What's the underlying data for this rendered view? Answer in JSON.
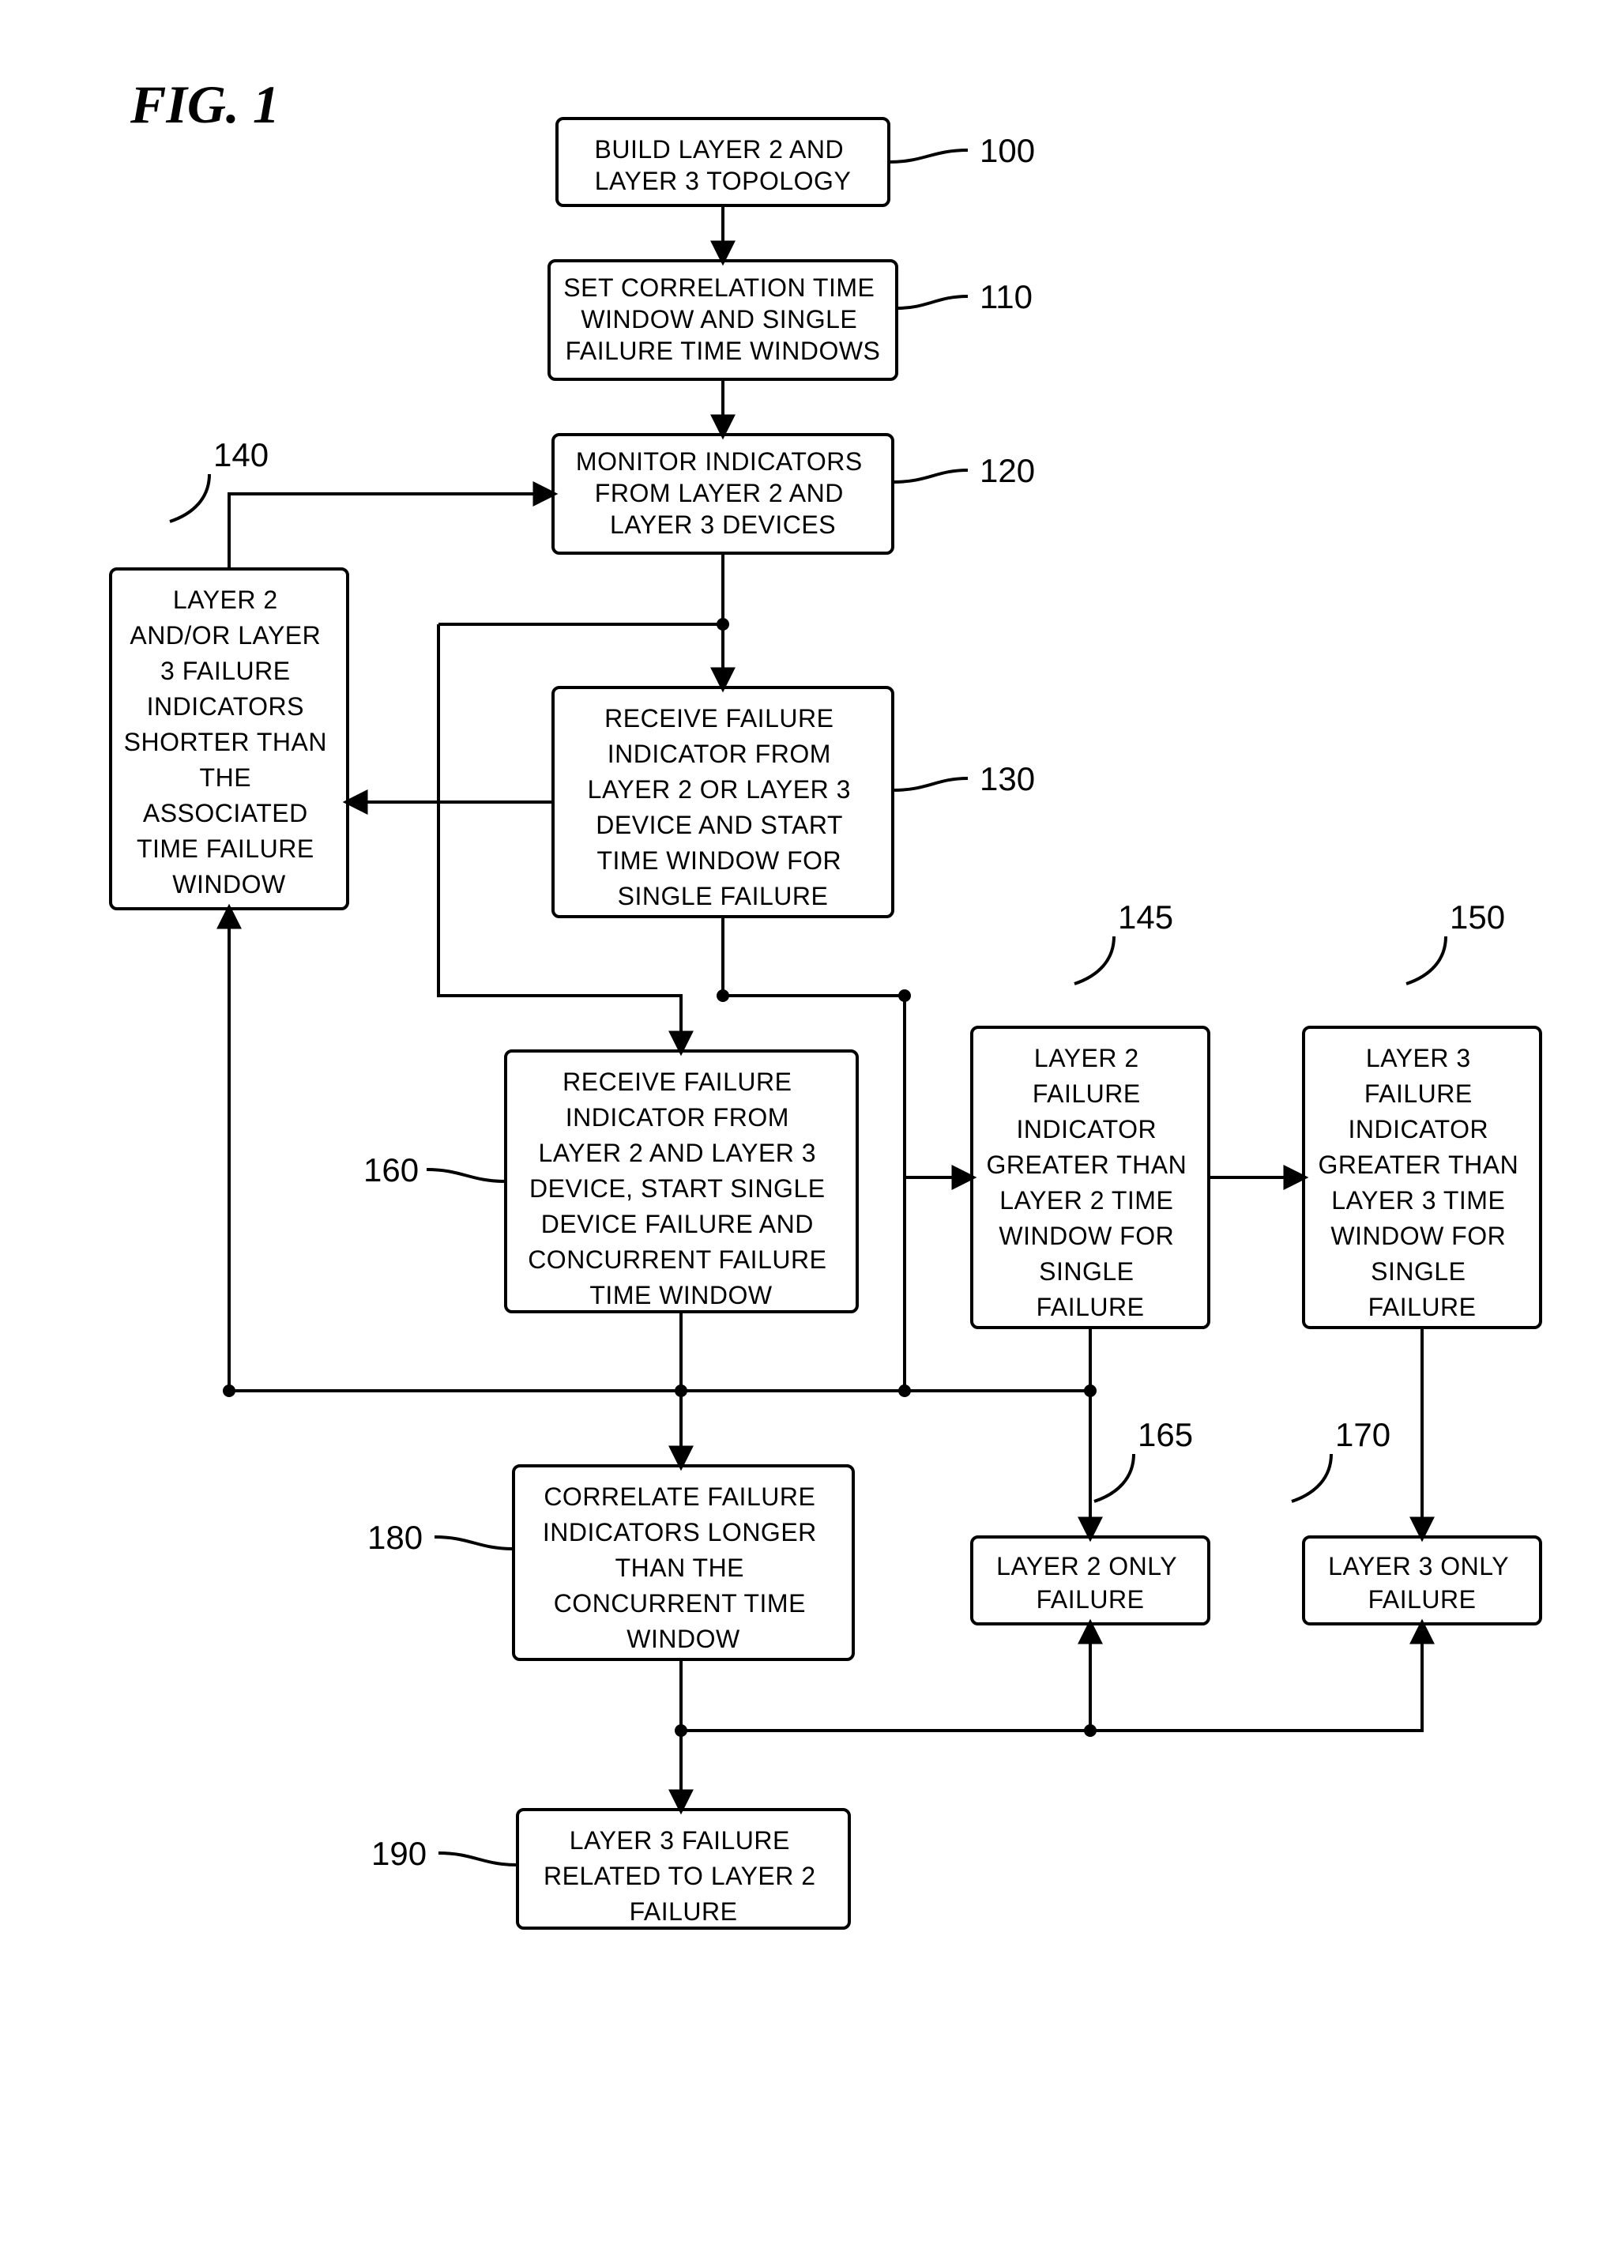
{
  "figure_title": "FIG. 1",
  "nodes": {
    "n100": {
      "ref": "100",
      "lines": [
        "BUILD LAYER 2 AND",
        "LAYER 3 TOPOLOGY"
      ]
    },
    "n110": {
      "ref": "110",
      "lines": [
        "SET CORRELATION TIME",
        "WINDOW AND SINGLE",
        "FAILURE TIME WINDOWS"
      ]
    },
    "n120": {
      "ref": "120",
      "lines": [
        "MONITOR INDICATORS",
        "FROM LAYER 2 AND",
        "LAYER 3 DEVICES"
      ]
    },
    "n130": {
      "ref": "130",
      "lines": [
        "RECEIVE FAILURE",
        "INDICATOR FROM",
        "LAYER 2 OR LAYER 3",
        "DEVICE AND START",
        "TIME WINDOW FOR",
        "SINGLE FAILURE"
      ]
    },
    "n140": {
      "ref": "140",
      "lines": [
        "LAYER 2",
        "AND/OR LAYER",
        "3 FAILURE",
        "INDICATORS",
        "SHORTER THAN",
        "THE",
        "ASSOCIATED",
        "TIME FAILURE",
        "WINDOW"
      ]
    },
    "n145": {
      "ref": "145",
      "lines": [
        "LAYER 2",
        "FAILURE",
        "INDICATOR",
        "GREATER THAN",
        "LAYER 2 TIME",
        "WINDOW FOR",
        "SINGLE",
        "FAILURE"
      ]
    },
    "n150": {
      "ref": "150",
      "lines": [
        "LAYER 3",
        "FAILURE",
        "INDICATOR",
        "GREATER THAN",
        "LAYER 3 TIME",
        "WINDOW FOR",
        "SINGLE",
        "FAILURE"
      ]
    },
    "n160": {
      "ref": "160",
      "lines": [
        "RECEIVE FAILURE",
        "INDICATOR FROM",
        "LAYER 2 AND LAYER 3",
        "DEVICE, START SINGLE",
        "DEVICE FAILURE AND",
        "CONCURRENT FAILURE",
        "TIME WINDOW"
      ]
    },
    "n165": {
      "ref": "165",
      "lines": [
        "LAYER 2 ONLY",
        "FAILURE"
      ]
    },
    "n170": {
      "ref": "170",
      "lines": [
        "LAYER 3 ONLY",
        "FAILURE"
      ]
    },
    "n180": {
      "ref": "180",
      "lines": [
        "CORRELATE FAILURE",
        "INDICATORS LONGER",
        "THAN THE",
        "CONCURRENT TIME",
        "WINDOW"
      ]
    },
    "n190": {
      "ref": "190",
      "lines": [
        "LAYER 3 FAILURE",
        "RELATED TO LAYER 2",
        "FAILURE"
      ]
    }
  }
}
